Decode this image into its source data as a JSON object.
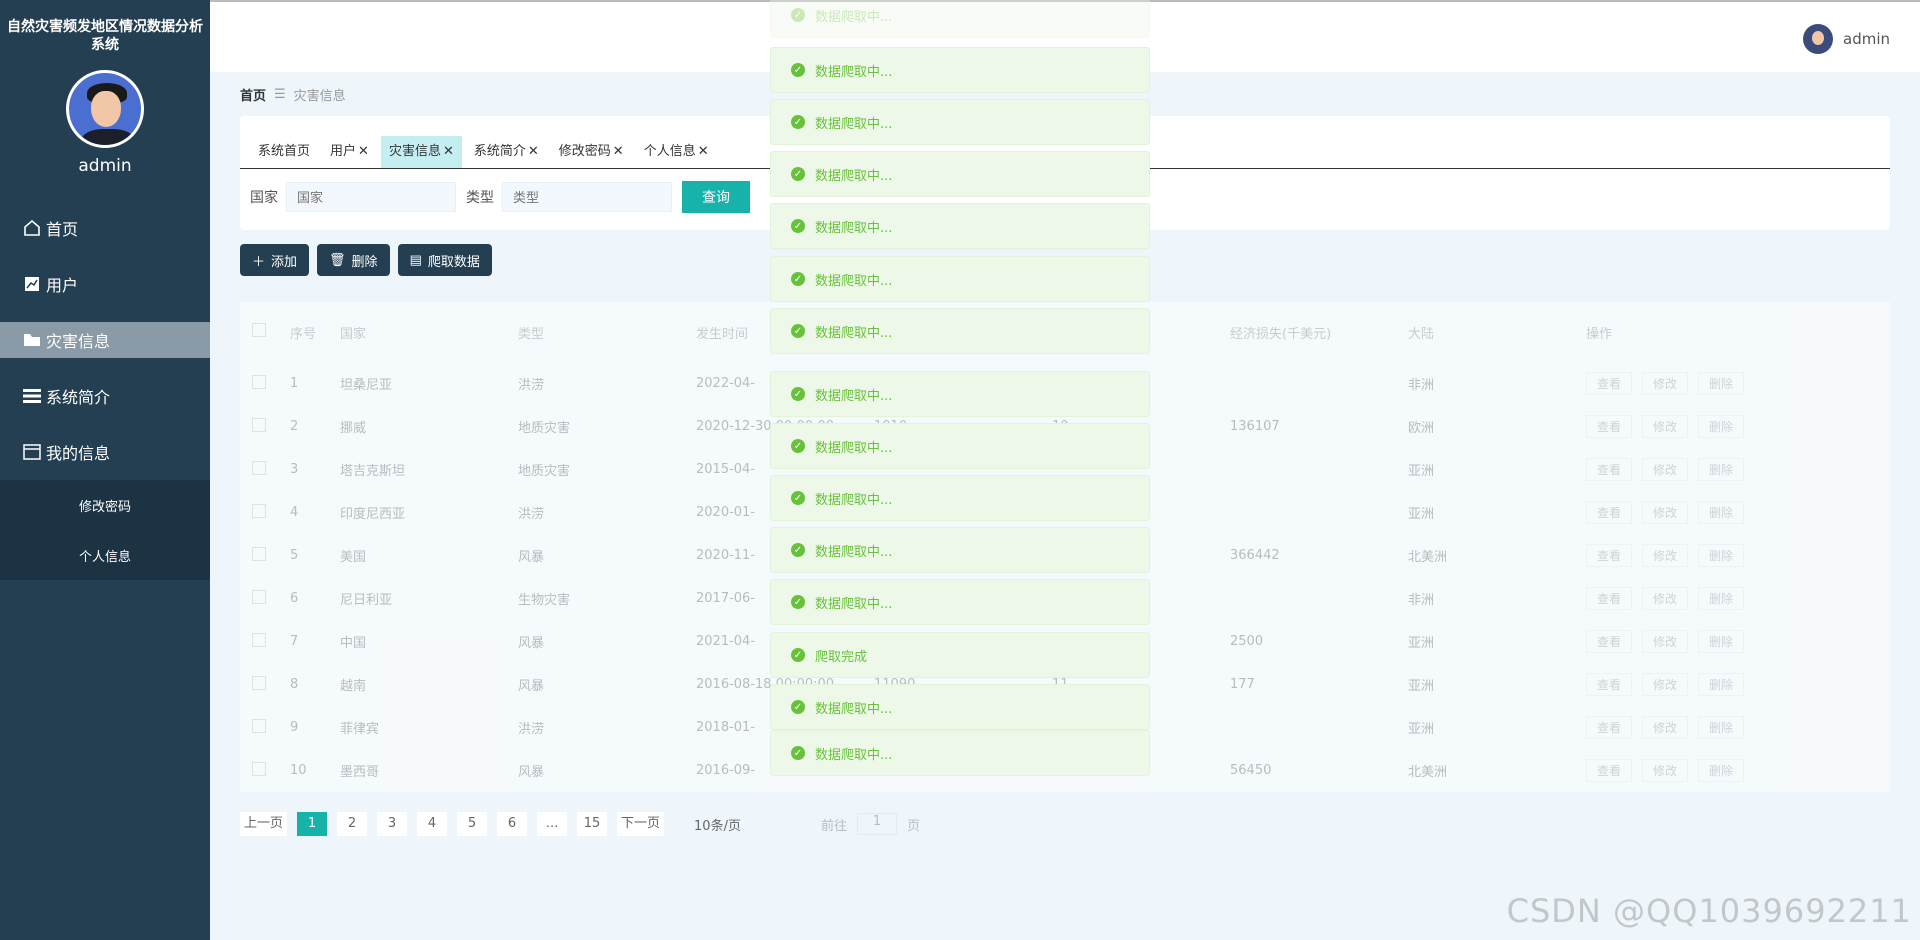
{
  "app": {
    "title": "自然灾害频发地区情况数据分析系统",
    "user": "admin"
  },
  "sidebar": {
    "items": [
      {
        "label": "首页",
        "icon": "home-icon"
      },
      {
        "label": "用户",
        "icon": "chart-icon"
      },
      {
        "label": "灾害信息",
        "icon": "flag-icon",
        "active": true
      },
      {
        "label": "系统简介",
        "icon": "list-icon"
      },
      {
        "label": "我的信息",
        "icon": "card-icon"
      }
    ],
    "subitems": [
      "修改密码",
      "个人信息"
    ]
  },
  "breadcrumb": {
    "home": "首页",
    "sep": "☰",
    "current": "灾害信息"
  },
  "tabs": [
    {
      "label": "系统首页",
      "closable": false
    },
    {
      "label": "用户",
      "closable": true
    },
    {
      "label": "灾害信息",
      "closable": true,
      "active": true
    },
    {
      "label": "系统简介",
      "closable": true
    },
    {
      "label": "修改密码",
      "closable": true
    },
    {
      "label": "个人信息",
      "closable": true
    }
  ],
  "search": {
    "country_label": "国家",
    "country_placeholder": "国家",
    "type_label": "类型",
    "type_placeholder": "类型",
    "query_button": "查询"
  },
  "actions": {
    "add": "添加",
    "delete": "删除",
    "crawl": "爬取数据"
  },
  "table": {
    "headers": [
      "序号",
      "国家",
      "类型",
      "发生时间",
      "",
      "",
      "经济损失(千美元)",
      "大陆",
      "操作"
    ],
    "ops": [
      "查看",
      "修改",
      "删除"
    ],
    "rows": [
      [
        "1",
        "坦桑尼亚",
        "洪涝",
        "2022-04-",
        "",
        "",
        "",
        "非洲"
      ],
      [
        "2",
        "挪威",
        "地质灾害",
        "2020-12-30 00:00:00",
        "1010",
        "10",
        "136107",
        "欧洲"
      ],
      [
        "3",
        "塔吉克斯坦",
        "地质灾害",
        "2015-04-",
        "",
        "",
        "",
        "亚洲"
      ],
      [
        "4",
        "印度尼西亚",
        "洪涝",
        "2020-01-",
        "",
        "",
        "",
        "亚洲"
      ],
      [
        "5",
        "美国",
        "风暴",
        "2020-11-",
        "",
        "",
        "366442",
        "北美洲"
      ],
      [
        "6",
        "尼日利亚",
        "生物灾害",
        "2017-06-",
        "",
        "",
        "",
        "非洲"
      ],
      [
        "7",
        "中国",
        "风暴",
        "2021-04-",
        "",
        "",
        "2500",
        "亚洲"
      ],
      [
        "8",
        "越南",
        "风暴",
        "2016-08-18 00:00:00",
        "11090",
        "11",
        "177",
        "亚洲"
      ],
      [
        "9",
        "菲律宾",
        "洪涝",
        "2018-01-",
        "",
        "",
        "",
        "亚洲"
      ],
      [
        "10",
        "墨西哥",
        "风暴",
        "2016-09-",
        "",
        "",
        "56450",
        "北美洲"
      ]
    ]
  },
  "pagination": {
    "prev": "上一页",
    "next": "下一页",
    "pages": [
      "1",
      "2",
      "3",
      "4",
      "5",
      "6",
      "...",
      "15"
    ],
    "current": "1",
    "per_page": "10条/页",
    "goto_prefix": "前往",
    "goto_suffix": "页"
  },
  "toasts": [
    "数据爬取中...",
    "数据爬取中...",
    "数据爬取中...",
    "数据爬取中...",
    "数据爬取中...",
    "数据爬取中...",
    "数据爬取中...",
    "数据爬取中...",
    "数据爬取中...",
    "数据爬取中...",
    "数据爬取中...",
    "数据爬取中...",
    "爬取完成",
    "数据爬取中...",
    "数据爬取中..."
  ],
  "watermark": "CSDN @QQ1039692211",
  "colors": {
    "sidebar": "#243f52",
    "accent": "#17b2a9",
    "success": "#67c23a"
  }
}
